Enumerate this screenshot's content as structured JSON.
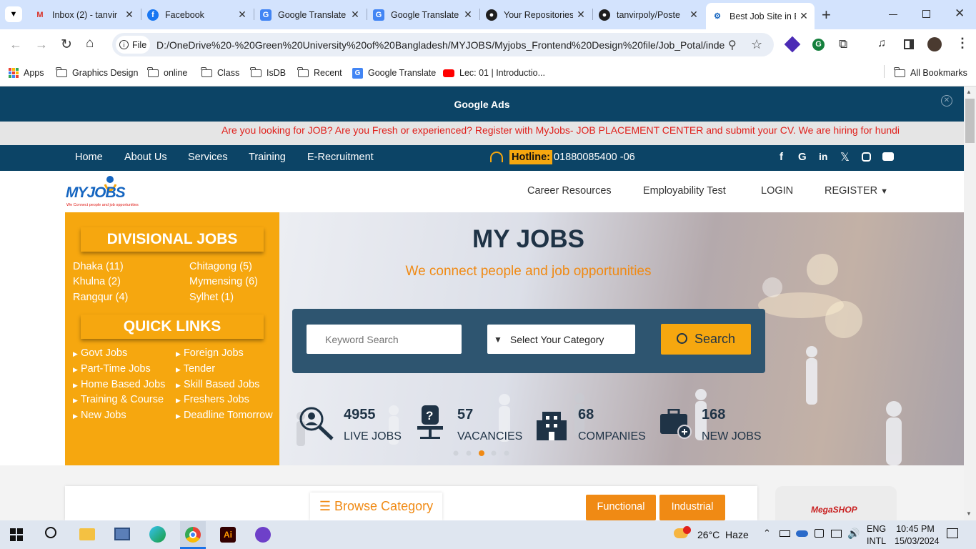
{
  "browser": {
    "tabs": [
      {
        "title": "Inbox (2) - tanvir",
        "icon": "gmail-icon"
      },
      {
        "title": "Facebook",
        "icon": "facebook-icon"
      },
      {
        "title": "Google Translate",
        "icon": "google-translate-icon"
      },
      {
        "title": "Google Translate",
        "icon": "google-translate-icon"
      },
      {
        "title": "Your Repositories",
        "icon": "github-icon"
      },
      {
        "title": "tanvirpoly/Poste",
        "icon": "github-icon"
      },
      {
        "title": "Best Job Site in B",
        "icon": "myjobs-icon"
      }
    ],
    "address_label": "File",
    "url": "D:/OneDrive%20-%20Green%20University%20of%20Bangladesh/MYJOBS/Myjobs_Frontend%20Design%20file/Job_Potal/index...",
    "bookmarks": [
      "Apps",
      "Graphics Design",
      "online",
      "Class",
      "IsDB",
      "Recent",
      "Google Translate",
      "Lec: 01 | Introductio..."
    ],
    "all_bookmarks": "All Bookmarks"
  },
  "page": {
    "ads_label": "Google Ads",
    "marquee": "Are you looking for JOB? Are you Fresh or experienced? Register with MyJobs- JOB PLACEMENT CENTER and submit your CV. We are hiring for hundi",
    "nav": [
      "Home",
      "About Us",
      "Services",
      "Training",
      "E-Recruitment"
    ],
    "hotline_label": "Hotline:",
    "hotline_number": "01880085400 -06",
    "social": [
      "facebook-icon",
      "google-icon",
      "linkedin-icon",
      "x-icon",
      "instagram-icon",
      "youtube-icon"
    ],
    "logo": {
      "text": "MYJOBS",
      "tagline": "We Connect people and job opportunities"
    },
    "header_links": [
      "Career Resources",
      "Employability Test",
      "LOGIN",
      "REGISTER"
    ],
    "divisional_title": "DIVISIONAL JOBS",
    "divisions": [
      "Dhaka (11)",
      "Chitagong (5)",
      "Khulna (2)",
      "Mymensing (6)",
      "Rangqur (4)",
      "Sylhet (1)"
    ],
    "quick_title": "QUICK LINKS",
    "quick_links": [
      "Govt Jobs",
      "Foreign Jobs",
      "Part-Time Jobs",
      "Tender",
      "Home Based Jobs",
      "Skill Based Jobs",
      "Training & Course",
      "Freshers Jobs",
      "New Jobs",
      "Deadline Tomorrow"
    ],
    "hero_title": "MY JOBS",
    "hero_subtitle": "We connect people and job opportunities",
    "search_placeholder": "Keyword Search",
    "category_label": "Select Your Category",
    "search_button": "Search",
    "stats": [
      {
        "num": "4955",
        "label": "LIVE JOBS"
      },
      {
        "num": "57",
        "label": "VACANCIES"
      },
      {
        "num": "68",
        "label": "COMPANIES"
      },
      {
        "num": "168",
        "label": "NEW JOBS"
      }
    ],
    "browse_label": "Browse Category",
    "tab_functional": "Functional",
    "tab_industrial": "Industrial",
    "ad_shop": "MegaSHOP"
  },
  "taskbar": {
    "weather": "26°C  Haze",
    "lang": "ENG",
    "lang2": "INTL",
    "time": "10:45 PM",
    "date": "15/03/2024"
  }
}
